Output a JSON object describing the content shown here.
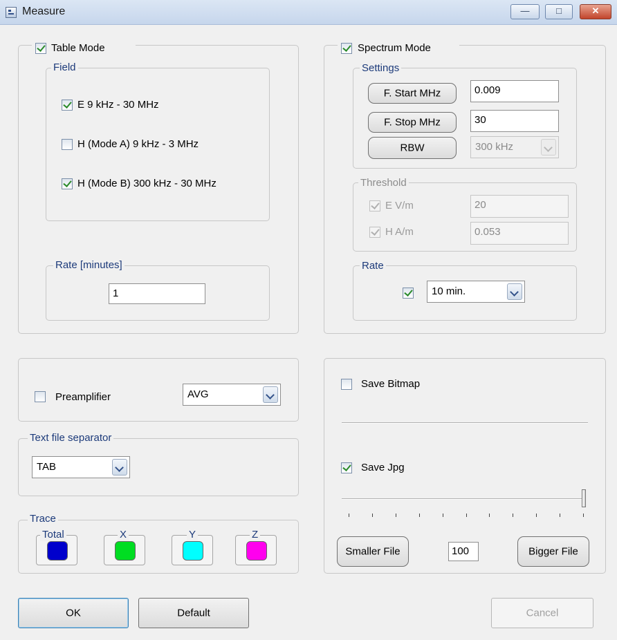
{
  "window": {
    "title": "Measure",
    "minimize_glyph": "—",
    "maximize_glyph": "□",
    "close_glyph": "✕"
  },
  "table_mode": {
    "label": "Table Mode",
    "checked": true,
    "field": {
      "label": "Field",
      "options": [
        {
          "label": "E 9 kHz - 30 MHz",
          "checked": true
        },
        {
          "label": "H (Mode A) 9 kHz - 3 MHz",
          "checked": false
        },
        {
          "label": "H (Mode B) 300 kHz - 30 MHz",
          "checked": true
        }
      ]
    },
    "rate": {
      "label": "Rate [minutes]",
      "value": "1"
    }
  },
  "spectrum_mode": {
    "label": "Spectrum Mode",
    "checked": true,
    "settings": {
      "label": "Settings",
      "f_start_button": "F. Start MHz",
      "f_start_value": "0.009",
      "f_stop_button": "F. Stop MHz",
      "f_stop_value": "30",
      "rbw_button": "RBW",
      "rbw_value": "300 kHz"
    },
    "threshold": {
      "label": "Threshold",
      "e_label": "E V/m",
      "e_value": "20",
      "h_label": "H A/m",
      "h_value": "0.053"
    },
    "rate": {
      "label": "Rate",
      "checked": true,
      "value": "10 min."
    }
  },
  "preamplifier": {
    "label": "Preamplifier",
    "checked": false,
    "detector": "AVG"
  },
  "separator": {
    "label": "Text file separator",
    "value": "TAB"
  },
  "trace": {
    "label": "Trace",
    "items": [
      {
        "label": "Total",
        "color": "#0000cc"
      },
      {
        "label": "X",
        "color": "#00dd22"
      },
      {
        "label": "Y",
        "color": "#00ffff"
      },
      {
        "label": "Z",
        "color": "#ff00ee"
      }
    ]
  },
  "save": {
    "bitmap_label": "Save Bitmap",
    "bitmap_checked": false,
    "jpg_label": "Save Jpg",
    "jpg_checked": true,
    "quality_value": "100",
    "quality_fraction": 1.0,
    "smaller_button": "Smaller File",
    "bigger_button": "Bigger File"
  },
  "footer": {
    "ok": "OK",
    "default": "Default",
    "cancel": "Cancel"
  }
}
